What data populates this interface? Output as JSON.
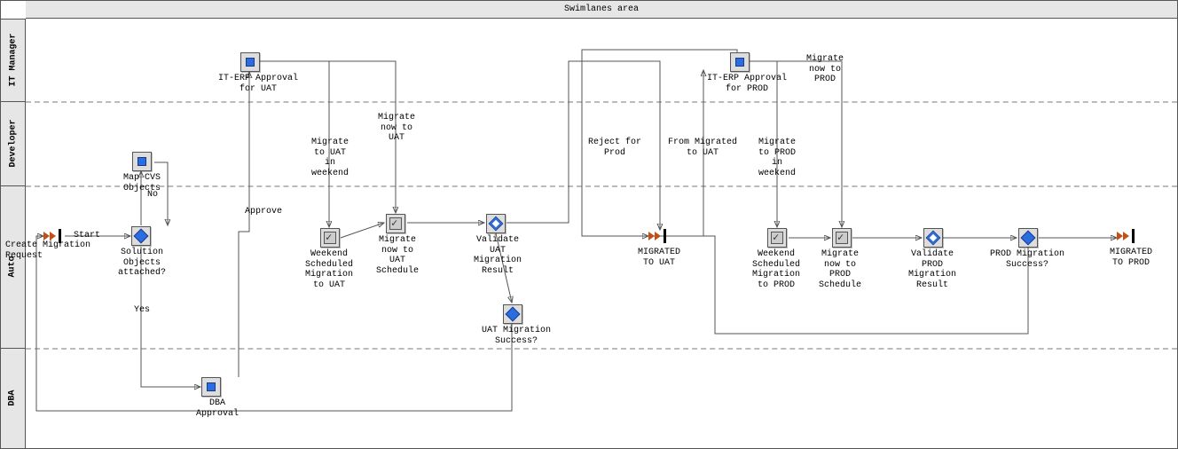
{
  "title": "Swimlanes area",
  "lanes": {
    "l0": "IT Manager",
    "l1": "Developer",
    "l2": "Auto",
    "l3": "DBA"
  },
  "labels": {
    "start": "Start",
    "create_req": "Create Migration\nRequest",
    "solution": "Solution\nObjects\nattached?",
    "map_cvs": "Map CVS\nObjects",
    "no": "No",
    "yes": "Yes",
    "dba_appr": "DBA\nApproval",
    "approve": "Approve",
    "iterp_uat": "IT-ERP Approval\nfor UAT",
    "mig_uat_wknd": "Migrate\nto UAT\nin\nweekend",
    "mig_now_uat": "Migrate\nnow to\nUAT",
    "wknd_sched_uat": "Weekend\nScheduled\nMigration\nto UAT",
    "mig_uat_sched": "Migrate\nnow to\nUAT\nSchedule",
    "val_uat": "Validate\nUAT\nMigration\nResult",
    "uat_success": "UAT Migration\nSuccess?",
    "migrated_uat": "MIGRATED\nTO UAT",
    "reject_prod": "Reject for\nProd",
    "from_mig_uat": "From Migrated\nto UAT",
    "iterp_prod": "IT-ERP Approval\nfor PROD",
    "mig_now_prod": "Migrate\nnow to\nPROD",
    "mig_prod_wknd": "Migrate\nto PROD\nin\nweekend",
    "wknd_sched_prod": "Weekend\nScheduled\nMigration\nto PROD",
    "mig_prod_sched": "Migrate\nnow to\nPROD\nSchedule",
    "val_prod": "Validate\nPROD\nMigration\nResult",
    "prod_success": "PROD Migration\nSuccess?",
    "migrated_prod": "MIGRATED\nTO PROD"
  }
}
